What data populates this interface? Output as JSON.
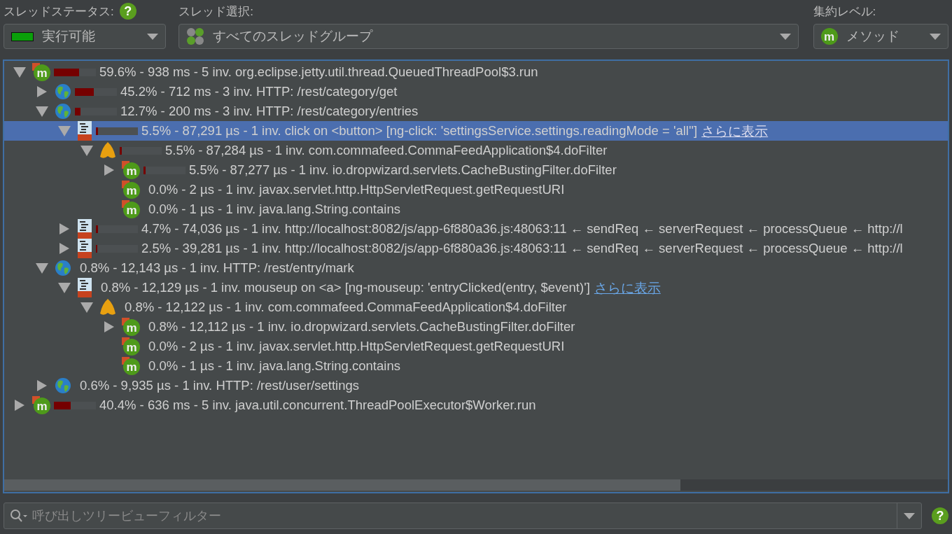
{
  "toolbar": {
    "thread_status": {
      "label": "スレッドステータス:",
      "help": "?",
      "value": "実行可能"
    },
    "thread_selection": {
      "label": "スレッド選択:",
      "value": "すべてのスレッドグループ"
    },
    "aggregation": {
      "label": "集約レベル:",
      "badge": "m",
      "value": "メソッド"
    }
  },
  "tree": [
    {
      "kind": "method",
      "badge": "m",
      "level": 0.596,
      "text": "59.6% - 938 ms - 5 inv. org.eclipse.jetty.util.thread.QueuedThreadPool$3.run",
      "selected": false,
      "expanded": true,
      "children": [
        {
          "kind": "http",
          "level": 0.452,
          "text": "45.2% - 712 ms - 3 inv. HTTP: /rest/category/get",
          "selected": false,
          "expanded": false
        },
        {
          "kind": "http",
          "level": 0.127,
          "text": "12.7% - 200 ms - 3 inv. HTTP: /rest/category/entries",
          "selected": false,
          "expanded": true,
          "children": [
            {
              "kind": "js",
              "level": 0.055,
              "text": "5.5% - 87,291 µs - 1 inv. click on <button> [ng-click: 'settingsService.settings.readingMode = 'all'']",
              "link": "さらに表示",
              "selected": true,
              "expanded": true,
              "children": [
                {
                  "kind": "filter",
                  "level": 0.055,
                  "text": "5.5% - 87,284 µs - 1 inv. com.commafeed.CommaFeedApplication$4.doFilter",
                  "selected": false,
                  "expanded": true,
                  "children": [
                    {
                      "kind": "method",
                      "badge": "m",
                      "level": 0.055,
                      "text": "5.5% - 87,277 µs - 1 inv. io.dropwizard.servlets.CacheBustingFilter.doFilter",
                      "selected": false,
                      "expanded": false
                    },
                    {
                      "kind": "method",
                      "badge": "m",
                      "text": "0.0% - 2 µs - 1 inv. javax.servlet.http.HttpServletRequest.getRequestURI",
                      "selected": false
                    },
                    {
                      "kind": "method",
                      "badge": "m",
                      "text": "0.0% - 1 µs - 1 inv. java.lang.String.contains",
                      "selected": false
                    }
                  ]
                }
              ]
            },
            {
              "kind": "js",
              "level": 0.047,
              "text": "4.7% - 74,036 µs - 1 inv. http://localhost:8082/js/app-6f880a36.js:48063:11 ← sendReq ← serverRequest ← processQueue ← http://l",
              "selected": false,
              "expanded": false
            },
            {
              "kind": "js",
              "level": 0.025,
              "text": "2.5% - 39,281 µs - 1 inv. http://localhost:8082/js/app-6f880a36.js:48063:11 ← sendReq ← serverRequest ← processQueue ← http://l",
              "selected": false,
              "expanded": false
            }
          ]
        },
        {
          "kind": "http",
          "text": "0.8% - 12,143 µs - 1 inv. HTTP: /rest/entry/mark",
          "selected": false,
          "expanded": true,
          "children": [
            {
              "kind": "js",
              "text": "0.8% - 12,129 µs - 1 inv. mouseup on <a> [ng-mouseup: 'entryClicked(entry, $event)']",
              "link": "さらに表示",
              "selected": false,
              "expanded": true,
              "children": [
                {
                  "kind": "filter",
                  "text": "0.8% - 12,122 µs - 1 inv. com.commafeed.CommaFeedApplication$4.doFilter",
                  "selected": false,
                  "expanded": true,
                  "children": [
                    {
                      "kind": "method",
                      "badge": "m",
                      "text": "0.8% - 12,112 µs - 1 inv. io.dropwizard.servlets.CacheBustingFilter.doFilter",
                      "selected": false,
                      "expanded": false
                    },
                    {
                      "kind": "method",
                      "badge": "m",
                      "text": "0.0% - 2 µs - 1 inv. javax.servlet.http.HttpServletRequest.getRequestURI",
                      "selected": false
                    },
                    {
                      "kind": "method",
                      "badge": "m",
                      "text": "0.0% - 1 µs - 1 inv. java.lang.String.contains",
                      "selected": false
                    }
                  ]
                }
              ]
            }
          ]
        },
        {
          "kind": "http",
          "text": "0.6% - 9,935 µs - 1 inv. HTTP: /rest/user/settings",
          "selected": false,
          "expanded": false
        }
      ]
    },
    {
      "kind": "method",
      "badge": "m",
      "level": 0.404,
      "text": "40.4% - 636 ms - 5 inv. java.util.concurrent.ThreadPoolExecutor$Worker.run",
      "selected": false,
      "expanded": false
    }
  ],
  "filter": {
    "placeholder": "呼び出しツリービューフィルター",
    "help": "?"
  }
}
